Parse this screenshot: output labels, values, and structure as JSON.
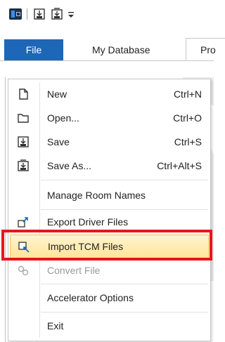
{
  "ribbon": {
    "tabs": {
      "file": "File",
      "my_database": "My Database",
      "partial": "Pro"
    }
  },
  "file_menu": {
    "items": [
      {
        "label": "New",
        "shortcut": "Ctrl+N"
      },
      {
        "label": "Open...",
        "shortcut": "Ctrl+O"
      },
      {
        "label": "Save",
        "shortcut": "Ctrl+S"
      },
      {
        "label": "Save As...",
        "shortcut": "Ctrl+Alt+S"
      },
      {
        "label": "Manage Room Names",
        "shortcut": ""
      },
      {
        "label": "Export Driver Files",
        "shortcut": ""
      },
      {
        "label": "Import TCM Files",
        "shortcut": ""
      },
      {
        "label": "Convert File",
        "shortcut": ""
      },
      {
        "label": "Accelerator Options",
        "shortcut": ""
      },
      {
        "label": "Exit",
        "shortcut": ""
      }
    ],
    "highlighted_item": "Import TCM Files",
    "disabled_item": "Convert File"
  },
  "colors": {
    "file_tab": "#1e66b8",
    "highlight_fill": "#ffe49a",
    "annotation_border": "#e8141e"
  },
  "icons": {
    "app": "app-logo-icon",
    "qat_save": "save-icon",
    "qat_save_as": "save-as-icon",
    "qat_customize": "chevron-down-icon"
  }
}
